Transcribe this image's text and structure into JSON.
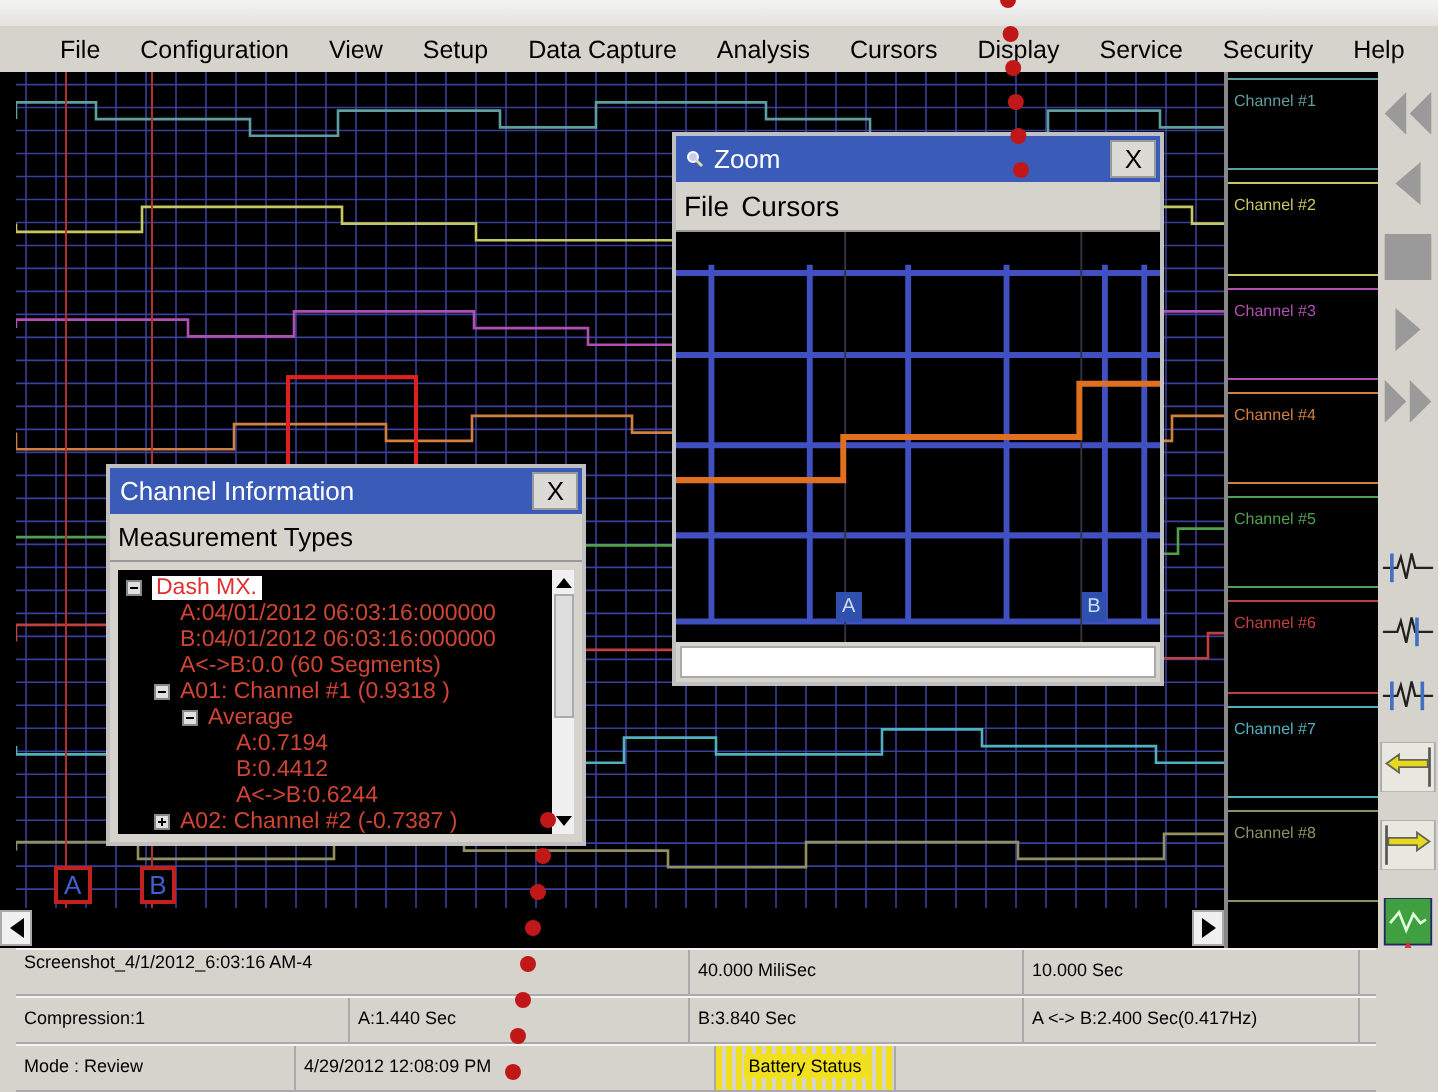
{
  "menu": [
    "File",
    "Configuration",
    "View",
    "Setup",
    "Data Capture",
    "Analysis",
    "Cursors",
    "Display",
    "Service",
    "Security",
    "Help"
  ],
  "channels": [
    {
      "label": "Channel #1",
      "color": "#5f9ea0"
    },
    {
      "label": "Channel #2",
      "color": "#c8c860"
    },
    {
      "label": "Channel #3",
      "color": "#b050b0"
    },
    {
      "label": "Channel #4",
      "color": "#d08040"
    },
    {
      "label": "Channel #5",
      "color": "#50a050"
    },
    {
      "label": "Channel #6",
      "color": "#c04040"
    },
    {
      "label": "Channel #7",
      "color": "#50b0c0"
    },
    {
      "label": "Channel #8",
      "color": "#909060"
    }
  ],
  "cursors": [
    "A",
    "B"
  ],
  "zoom_window": {
    "title": "Zoom",
    "close": "X",
    "menu": [
      "File",
      "Cursors"
    ],
    "cursors": [
      "A",
      "B"
    ]
  },
  "channel_info": {
    "title": "Channel Information",
    "close": "X",
    "heading": "Measurement Types",
    "tree": [
      {
        "label": "Dash MX.",
        "selected": true,
        "expanded": true,
        "children": [
          {
            "label": "A:04/01/2012 06:03:16:000000",
            "selected": false
          },
          {
            "label": "B:04/01/2012 06:03:16:000000",
            "selected": false
          },
          {
            "label": "A<->B:0.0 (60 Segments)",
            "selected": false
          },
          {
            "label": "A01: Channel #1 (0.9318 )",
            "selected": false,
            "expanded": true,
            "children": [
              {
                "label": "Average",
                "selected": false,
                "expanded": true,
                "children": [
                  {
                    "label": "A:0.7194",
                    "selected": false
                  },
                  {
                    "label": "B:0.4412",
                    "selected": false
                  },
                  {
                    "label": "A<->B:0.6244",
                    "selected": false
                  }
                ]
              }
            ]
          },
          {
            "label": "A02: Channel #2 (-0.7387 )",
            "selected": false,
            "expanded": false
          }
        ]
      }
    ]
  },
  "status_rows": [
    [
      "Screenshot_4/1/2012_6:03:16 AM-4",
      "40.000 MiliSec",
      "10.000 Sec"
    ],
    [
      "Compression:1",
      "A:1.440 Sec",
      "B:3.840 Sec",
      "A <-> B:2.400 Sec(0.417Hz)"
    ],
    [
      "Mode : Review",
      "4/29/2012 12:08:09 PM",
      "Battery Status"
    ]
  ]
}
